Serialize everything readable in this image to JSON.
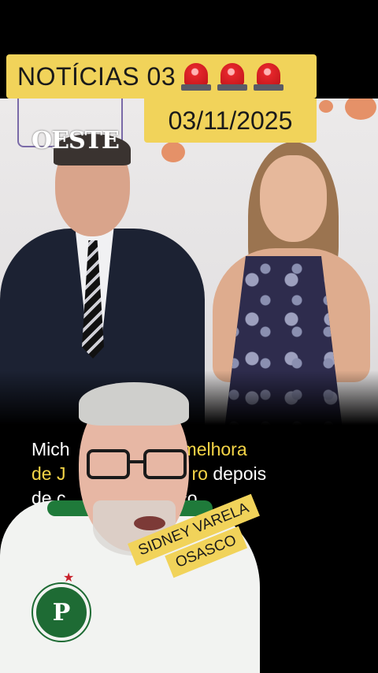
{
  "banner": {
    "title": "NOTÍCIAS 03",
    "date": "03/11/2025",
    "icons": [
      "police-light-icon",
      "police-light-icon",
      "police-light-icon"
    ]
  },
  "photo": {
    "logo_text": "OESTE"
  },
  "caption": {
    "line1_a": "Mich",
    "line1_b": "na melhora",
    "line2_a": "de J",
    "line2_b": "ro",
    "line2_c": " depois",
    "line3_a": "de c",
    "line3_b": "uço"
  },
  "name_tag": {
    "line1": "SIDNEY VARELA",
    "line2": "OSASCO"
  },
  "colors": {
    "banner_bg": "#f1d35a",
    "caption_highlight": "#f5d547",
    "background": "#000000"
  }
}
